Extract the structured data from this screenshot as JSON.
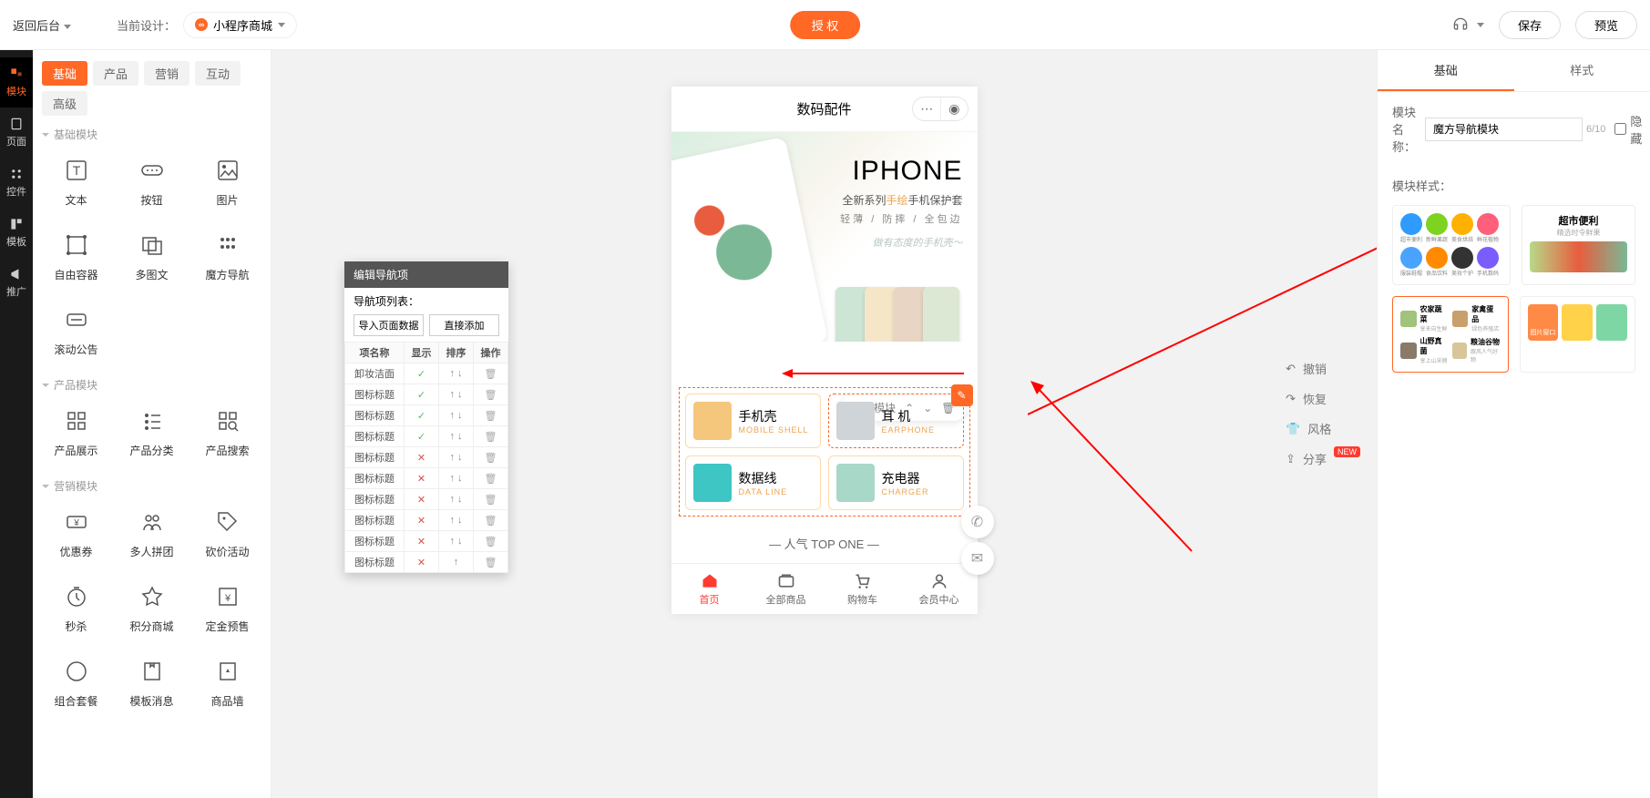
{
  "topbar": {
    "back": "返回后台",
    "current_label": "当前设计：",
    "design": "小程序商城",
    "auth": "授 权",
    "save": "保存",
    "preview": "预览"
  },
  "rail": [
    {
      "id": "modules",
      "label": "模块",
      "active": true
    },
    {
      "id": "pages",
      "label": "页面"
    },
    {
      "id": "controls",
      "label": "控件"
    },
    {
      "id": "templates",
      "label": "模板"
    },
    {
      "id": "promote",
      "label": "推广"
    }
  ],
  "palette": {
    "tabs": [
      {
        "id": "basic",
        "label": "基础",
        "active": true
      },
      {
        "id": "product",
        "label": "产品"
      },
      {
        "id": "marketing",
        "label": "营销"
      },
      {
        "id": "interact",
        "label": "互动"
      },
      {
        "id": "advanced",
        "label": "高级"
      }
    ],
    "sections": [
      {
        "title": "基础模块",
        "items": [
          {
            "id": "text",
            "label": "文本"
          },
          {
            "id": "button",
            "label": "按钮"
          },
          {
            "id": "image",
            "label": "图片"
          },
          {
            "id": "free",
            "label": "自由容器"
          },
          {
            "id": "multiimg",
            "label": "多图文"
          },
          {
            "id": "magicnav",
            "label": "魔方导航"
          },
          {
            "id": "scroll",
            "label": "滚动公告"
          }
        ]
      },
      {
        "title": "产品模块",
        "items": [
          {
            "id": "prodshow",
            "label": "产品展示"
          },
          {
            "id": "prodcat",
            "label": "产品分类"
          },
          {
            "id": "prodsearch",
            "label": "产品搜索"
          }
        ]
      },
      {
        "title": "营销模块",
        "items": [
          {
            "id": "coupon",
            "label": "优惠券"
          },
          {
            "id": "group",
            "label": "多人拼团"
          },
          {
            "id": "bargain",
            "label": "砍价活动"
          },
          {
            "id": "seckill",
            "label": "秒杀"
          },
          {
            "id": "points",
            "label": "积分商城"
          },
          {
            "id": "deposit",
            "label": "定金预售"
          },
          {
            "id": "combo",
            "label": "组合套餐"
          },
          {
            "id": "tpl",
            "label": "模板消息"
          },
          {
            "id": "wall",
            "label": "商品墙"
          }
        ]
      }
    ]
  },
  "popup": {
    "title": "编辑导航项",
    "list_label": "导航项列表：",
    "import": "导入页面数据",
    "add": "直接添加",
    "cols": {
      "name": "项名称",
      "show": "显示",
      "sort": "排序",
      "ops": "操作"
    },
    "rows": [
      {
        "name": "卸妆洁面",
        "show": true
      },
      {
        "name": "图标标题",
        "show": true
      },
      {
        "name": "图标标题",
        "show": true
      },
      {
        "name": "图标标题",
        "show": true
      },
      {
        "name": "图标标题",
        "show": false
      },
      {
        "name": "图标标题",
        "show": false
      },
      {
        "name": "图标标题",
        "show": false
      },
      {
        "name": "图标标题",
        "show": false
      },
      {
        "name": "图标标题",
        "show": false
      },
      {
        "name": "图标标题",
        "show": false
      }
    ]
  },
  "phone": {
    "title": "数码配件",
    "hero": {
      "h1": "IPHONE",
      "h2_pre": "全新系列",
      "h2_em": "手绘",
      "h2_post": "手机保护套",
      "h3": "轻薄 / 防摔 / 全包边",
      "h4": "做有态度的手机壳～"
    },
    "editbar": "编辑模块",
    "navs": [
      {
        "label": "手机壳",
        "sub": "MOBILE SHELL",
        "color": "#f4c77d"
      },
      {
        "label": "耳 机",
        "sub": "EARPHONE",
        "color": "#cfd4d8",
        "sel": true
      },
      {
        "label": "数据线",
        "sub": "DATA LINE",
        "color": "#3ec6c4"
      },
      {
        "label": "充电器",
        "sub": "CHARGER",
        "color": "#a8d8c8"
      }
    ],
    "topone": "— 人气 TOP ONE —",
    "tabs": [
      {
        "id": "home",
        "label": "首页",
        "active": true
      },
      {
        "id": "all",
        "label": "全部商品"
      },
      {
        "id": "cart",
        "label": "购物车"
      },
      {
        "id": "member",
        "label": "会员中心"
      }
    ]
  },
  "actions": {
    "undo": "撤销",
    "redo": "恢复",
    "style": "风格",
    "share": "分享",
    "new": "NEW"
  },
  "props": {
    "tabs": [
      {
        "id": "basic",
        "label": "基础",
        "active": true
      },
      {
        "id": "style",
        "label": "样式"
      }
    ],
    "name_label": "模块名称：",
    "name_value": "魔方导航模块",
    "name_count": "6/10",
    "hide": "隐藏",
    "style_label": "模块样式：",
    "style1_icons": [
      {
        "c": "#2f9bff",
        "l": "超市便利"
      },
      {
        "c": "#7ed321",
        "l": "新鲜果蔬"
      },
      {
        "c": "#ffb100",
        "l": "美食烘焙"
      },
      {
        "c": "#ff5f7a",
        "l": "鲜花植物"
      },
      {
        "c": "#ff7a45",
        "l": ""
      },
      {
        "c": "#4aa3ff",
        "l": "服装鞋帽"
      },
      {
        "c": "#ff8a00",
        "l": "食品饮料"
      },
      {
        "c": "#333",
        "l": "美妆个护"
      },
      {
        "c": "#7a5cff",
        "l": "手机数码"
      },
      {
        "c": "#bbb",
        "l": ""
      }
    ],
    "style2": {
      "title": "超市便利",
      "sub": "精选时令鲜果"
    },
    "style3": [
      {
        "t": "农家蔬菜",
        "s": "享来自生鲜",
        "c": "#9fc47a"
      },
      {
        "t": "家禽蛋品",
        "s": "绿色养殖店",
        "c": "#c9a06b"
      },
      {
        "t": "山野真菌",
        "s": "享上山采摘",
        "c": "#8a7a6a"
      },
      {
        "t": "粮油谷物",
        "s": "跟风人气好物",
        "c": "#d8c69a"
      }
    ],
    "style4": [
      {
        "c": "#ff8a45",
        "t": "图片窗口"
      },
      {
        "c": "#ffd24a"
      },
      {
        "c": "#7ed6a5"
      }
    ]
  }
}
